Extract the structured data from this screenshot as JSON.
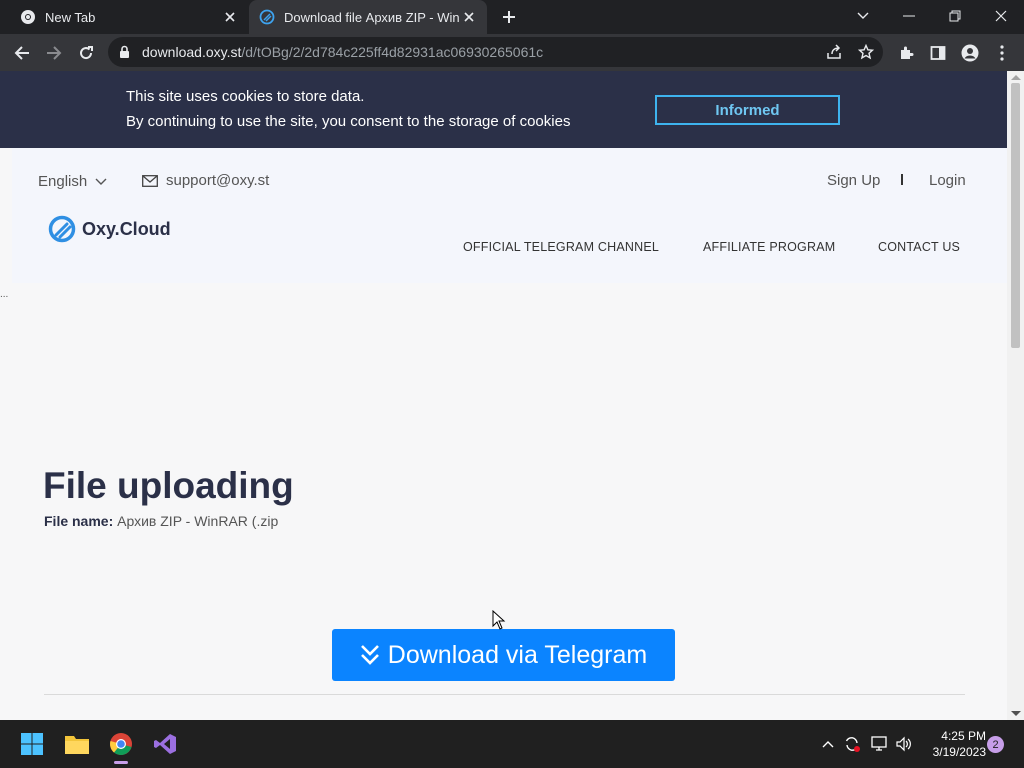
{
  "browser": {
    "tabs": [
      {
        "title": "New Tab"
      },
      {
        "title": "Download file Архив ZIP - WinRAR (.zip)"
      }
    ],
    "url_host": "download.oxy.st",
    "url_path": "/d/tOBg/2/2d784c225ff4d82931ac06930265061c"
  },
  "cookie_banner": {
    "line1": "This site uses cookies to store data.",
    "line2": "By continuing to use the site, you consent to the storage of cookies",
    "button": "Informed"
  },
  "header": {
    "language": "English",
    "email": "support@oxy.st",
    "sign_up": "Sign Up",
    "login": "Login",
    "logo": "Oxy.Cloud",
    "nav": [
      "OFFICIAL TELEGRAM CHANNEL",
      "AFFILIATE PROGRAM",
      "CONTACT US"
    ],
    "dots": "..."
  },
  "main": {
    "title": "File uploading",
    "file_label": "File name:",
    "file_name": "Архив ZIP - WinRAR (.zip",
    "download_button": "Download via Telegram"
  },
  "taskbar": {
    "time": "4:25 PM",
    "date": "3/19/2023",
    "notifications": "2"
  },
  "colors": {
    "accent": "#0b84ff",
    "cookie_bg": "#2b3048",
    "cookie_button_border": "#3eb3ee"
  }
}
